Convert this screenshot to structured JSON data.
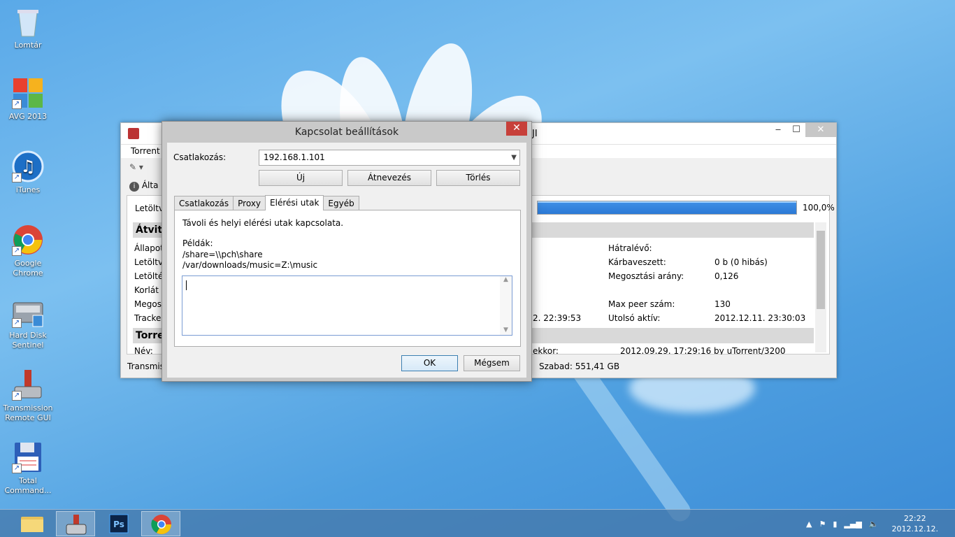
{
  "desktop": {
    "icons": [
      {
        "label": "Lomtár"
      },
      {
        "label": "AVG 2013"
      },
      {
        "label": "iTunes"
      },
      {
        "label": "Google Chrome"
      },
      {
        "label": "Hard Disk Sentinel"
      },
      {
        "label": "Transmission Remote GUI"
      },
      {
        "label": "Total Command..."
      }
    ]
  },
  "main_window": {
    "title_suffix": "JI",
    "menu": {
      "torrent": "Torrent"
    },
    "tab_general": "Álta",
    "downloaded_label": "Letöltve",
    "progress": 1.0,
    "progress_text": "100,0%",
    "section_transfer": "Átvite",
    "section_torrent": "Torren",
    "left_labels": [
      "Állapot:",
      "Letöltve",
      "Letöltés",
      "Korlát L",
      "Megoszt",
      "Tracker:",
      "Név:"
    ],
    "tracker_time": "2. 22:39:53",
    "right_labels": [
      "Hátralévő:",
      "Kárbaveszett:",
      "Megosztási arány:",
      "Max peer szám:",
      "Utolsó aktív:"
    ],
    "right_values": [
      "",
      "0 b (0 hibás)",
      "0,126",
      "130",
      "2012.12.11. 23:30:03"
    ],
    "created_by_label": "ekkor:",
    "created_by_value": "2012.09.29. 17:29:16 by uTorrent/3200",
    "status_left": "Transmis",
    "status_free": "Szabad: 551,41 GB"
  },
  "dialog": {
    "title": "Kapcsolat beállítások",
    "close": "✕",
    "connection_label": "Csatlakozás:",
    "connection_value": "192.168.1.101",
    "buttons": {
      "new": "Új",
      "rename": "Átnevezés",
      "delete": "Törlés",
      "ok": "OK",
      "cancel": "Mégsem"
    },
    "tabs": [
      "Csatlakozás",
      "Proxy",
      "Elérési utak",
      "Egyéb"
    ],
    "active_tab": "Elérési utak",
    "description": "Távoli és helyi elérési utak kapcsolata.",
    "examples_title": "Példák:",
    "example1": "/share=\\\\pch\\share",
    "example2": "/var/downloads/music=Z:\\music",
    "paths_value": ""
  },
  "taskbar": {
    "items": [
      "file-explorer",
      "transmission",
      "photoshop",
      "chrome"
    ],
    "clock_time": "22:22",
    "clock_date": "2012.12.12."
  }
}
